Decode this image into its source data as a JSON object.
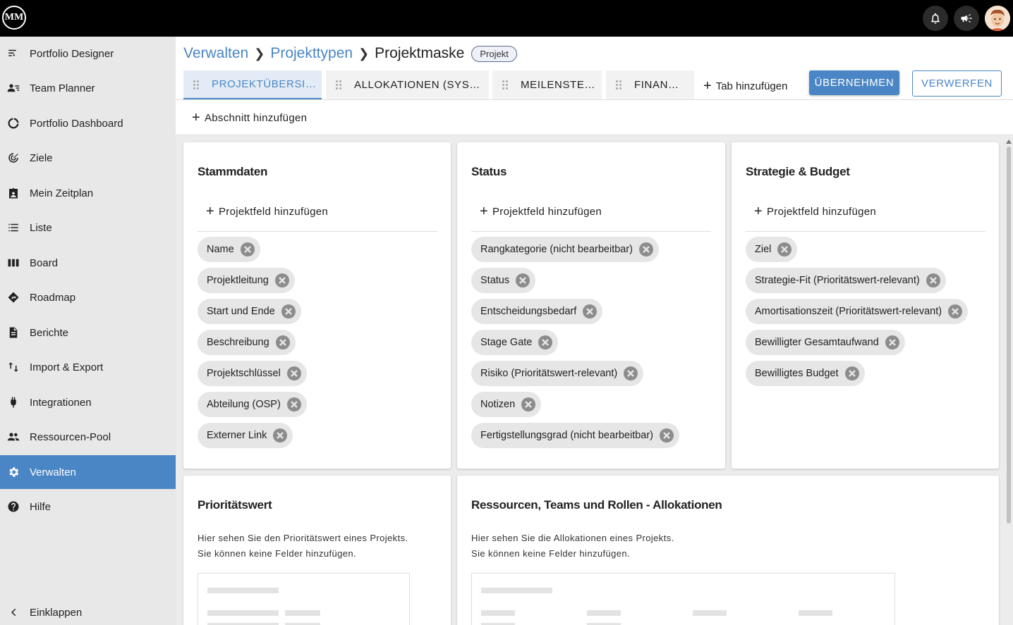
{
  "topbar": {
    "logo_text": "MM",
    "icons": [
      "bell-icon",
      "megaphone-icon",
      "user-avatar"
    ]
  },
  "sidebar": {
    "items": [
      {
        "label": "Portfolio Designer",
        "icon": "portfolio-designer-icon"
      },
      {
        "label": "Team Planner",
        "icon": "team-planner-icon"
      },
      {
        "label": "Portfolio Dashboard",
        "icon": "donut-chart-icon"
      },
      {
        "label": "Ziele",
        "icon": "target-icon"
      },
      {
        "label": "Mein Zeitplan",
        "icon": "badge-icon"
      },
      {
        "label": "Liste",
        "icon": "list-icon"
      },
      {
        "label": "Board",
        "icon": "board-icon"
      },
      {
        "label": "Roadmap",
        "icon": "roadmap-icon"
      },
      {
        "label": "Berichte",
        "icon": "report-icon"
      },
      {
        "label": "Import & Export",
        "icon": "import-export-icon"
      },
      {
        "label": "Integrationen",
        "icon": "plug-icon"
      },
      {
        "label": "Ressourcen-Pool",
        "icon": "people-icon"
      },
      {
        "label": "Verwalten",
        "icon": "gear-icon",
        "active": true
      },
      {
        "label": "Hilfe",
        "icon": "help-icon"
      }
    ],
    "collapse_label": "Einklappen"
  },
  "breadcrumb": {
    "items": [
      "Verwalten",
      "Projekttypen"
    ],
    "current": "Projektmaske",
    "badge": "Projekt"
  },
  "tabs": [
    {
      "label": "PROJEKTÜBERSI…",
      "active": true
    },
    {
      "label": "ALLOKATIONEN (SYS…"
    },
    {
      "label": "MEILENSTE…"
    },
    {
      "label": "FINAN…"
    }
  ],
  "actions": {
    "add_tab": "Tab hinzufügen",
    "apply": "ÜBERNEHMEN",
    "discard": "VERWERFEN",
    "add_section": "Abschnitt hinzufügen",
    "add_field": "Projektfeld hinzufügen"
  },
  "cards": [
    {
      "title": "Stammdaten",
      "chips": [
        "Name",
        "Projektleitung",
        "Start und Ende",
        "Beschreibung",
        "Projektschlüssel",
        "Abteilung (OSP)",
        "Externer Link"
      ]
    },
    {
      "title": "Status",
      "chips": [
        "Rangkategorie (nicht bearbeitbar)",
        "Status",
        "Entscheidungsbedarf",
        "Stage Gate",
        "Risiko (Prioritätswert-relevant)",
        "Notizen",
        "Fertigstellungsgrad (nicht bearbeitbar)"
      ]
    },
    {
      "title": "Strategie & Budget",
      "chips": [
        "Ziel",
        "Strategie-Fit (Prioritätswert-relevant)",
        "Amortisationszeit (Prioritätswert-relevant)",
        "Bewilligter Gesamtaufwand",
        "Bewilligtes Budget"
      ]
    }
  ],
  "info_cards": [
    {
      "title": "Prioritätswert",
      "line1": "Hier sehen Sie den Prioritätswert eines Projekts.",
      "line2": "Sie können keine Felder hinzufügen."
    },
    {
      "title": "Ressourcen, Teams und Rollen - Allokationen",
      "line1": "Hier sehen Sie die Allokationen eines Projekts.",
      "line2": "Sie können keine Felder hinzufügen."
    }
  ],
  "colors": {
    "accent": "#4a86c5",
    "topbar": "#000000",
    "sidebar": "#e8e8e8",
    "chip": "#e6e6e6"
  }
}
